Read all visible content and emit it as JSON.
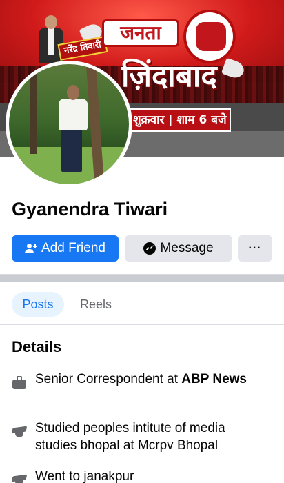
{
  "cover": {
    "name_badge": "नरेंद्र तिवारी",
    "title_line1": "जनता",
    "title_line2": "ज़िंदाबाद",
    "schedule": "शुक्रवार | शाम 6 बजे"
  },
  "profile": {
    "name": "Gyanendra Tiwari"
  },
  "actions": {
    "add_friend": "Add Friend",
    "message": "Message",
    "more": "···"
  },
  "tabs": [
    {
      "label": "Posts",
      "active": true
    },
    {
      "label": "Reels",
      "active": false
    }
  ],
  "details": {
    "title": "Details",
    "items": [
      {
        "icon": "briefcase-icon",
        "prefix": "Senior Correspondent at ",
        "bold": "ABP News"
      },
      {
        "icon": "graduation-cap-icon",
        "prefix": "Studied peoples intitute of media studies bhopal at Mcrpv Bhopal",
        "bold": ""
      },
      {
        "icon": "graduation-cap-icon",
        "prefix": "Went to janakpur",
        "bold": ""
      }
    ]
  },
  "colors": {
    "primary": "#1877f2",
    "secondary_button": "#e4e6eb",
    "tab_active_bg": "#e7f3ff",
    "muted_text": "#65676b"
  }
}
